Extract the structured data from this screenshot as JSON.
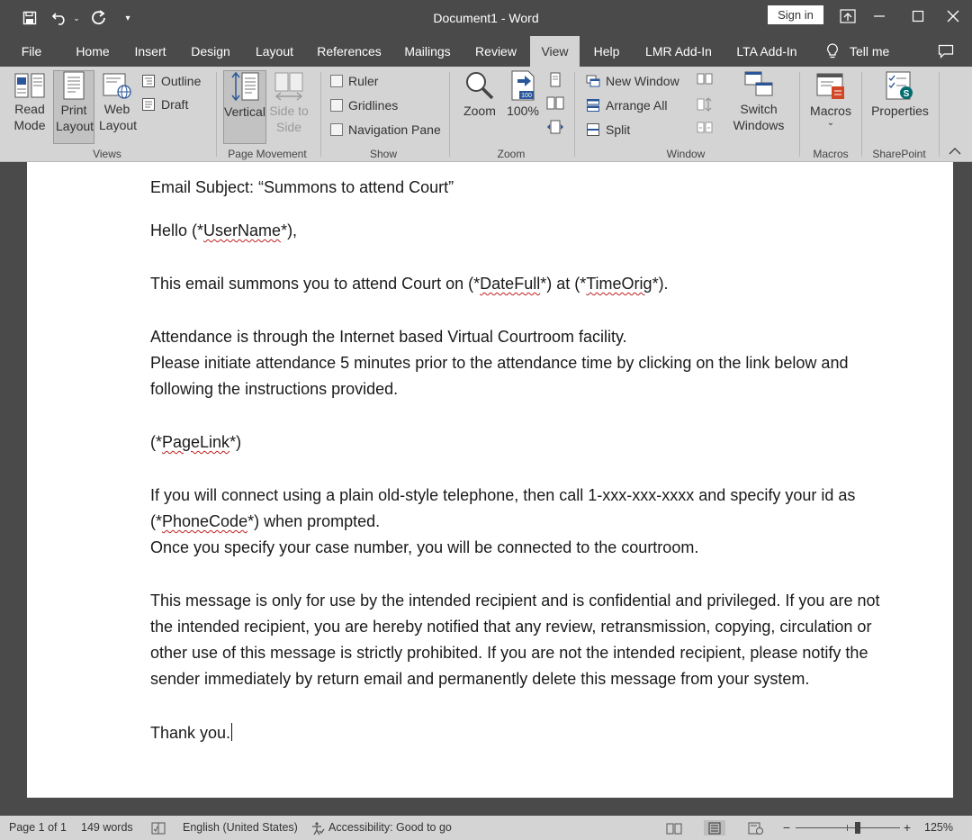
{
  "window": {
    "title": "Document1  -  Word",
    "sign_in": "Sign in"
  },
  "tabs": [
    "File",
    "Home",
    "Insert",
    "Design",
    "Layout",
    "References",
    "Mailings",
    "Review",
    "View",
    "Help",
    "LMR Add-In",
    "LTA Add-In"
  ],
  "tell_me": "Tell me",
  "ribbon": {
    "views": {
      "read_mode": "Read Mode",
      "print_layout": "Print Layout",
      "web_layout": "Web Layout",
      "outline": "Outline",
      "draft": "Draft",
      "label": "Views"
    },
    "page_movement": {
      "vertical": "Vertical",
      "side_to_side": "Side to Side",
      "label": "Page Movement"
    },
    "show": {
      "ruler": "Ruler",
      "gridlines": "Gridlines",
      "navigation_pane": "Navigation Pane",
      "label": "Show"
    },
    "zoom": {
      "zoom": "Zoom",
      "hundred": "100%",
      "label": "Zoom"
    },
    "window": {
      "new_window": "New Window",
      "arrange_all": "Arrange All",
      "split": "Split",
      "switch_windows": "Switch Windows",
      "label": "Window"
    },
    "macros": {
      "macros": "Macros",
      "label": "Macros"
    },
    "sharepoint": {
      "properties": "Properties",
      "label": "SharePoint"
    }
  },
  "document": {
    "subject": "Email Subject: “Summons to attend Court”",
    "greeting": {
      "pre": "Hello (*",
      "field": "UserName",
      "post": "*),"
    },
    "summons": {
      "pre": "This email summons you to attend Court on (*",
      "field1": "DateFull",
      "mid": "*) at (*",
      "field2": "TimeOrig",
      "post": "*)."
    },
    "attendance1": "Attendance is through the Internet based Virtual Courtroom facility.",
    "attendance2": "Please initiate attendance 5 minutes prior to the attendance time by clicking on the link below and",
    "attendance3": "following the instructions provided.",
    "pagelink": {
      "pre": "(*",
      "field": "PageLink",
      "post": "*)"
    },
    "phone1": "If you will connect using a plain old-style telephone, then call 1-xxx-xxx-xxxx and specify your id as",
    "phone2": {
      "pre": "(*",
      "field": "PhoneCode",
      "post": "*) when prompted."
    },
    "phone3": "Once you specify your case number, you will be connected to the courtroom.",
    "conf1": "This message is only for use by the intended recipient and is confidential and privileged. If you are not",
    "conf2": "the intended recipient, you are hereby notified that any review, retransmission, copying, circulation or",
    "conf3": "other use of this message is strictly prohibited. If you are not the intended recipient, please notify the",
    "conf4": "sender immediately by return email and permanently delete this message from your system.",
    "thanks": "Thank you."
  },
  "status": {
    "page": "Page 1 of 1",
    "words": "149 words",
    "language": "English (United States)",
    "accessibility": "Accessibility: Good to go",
    "zoom_minus": "−",
    "zoom_plus": "+",
    "zoom_level": "125%",
    "zoom_fraction": 0.6
  },
  "colors": {
    "chrome": "#4a4a4a",
    "ribbon": "#d4d4d4",
    "accent": "#2b579a"
  }
}
